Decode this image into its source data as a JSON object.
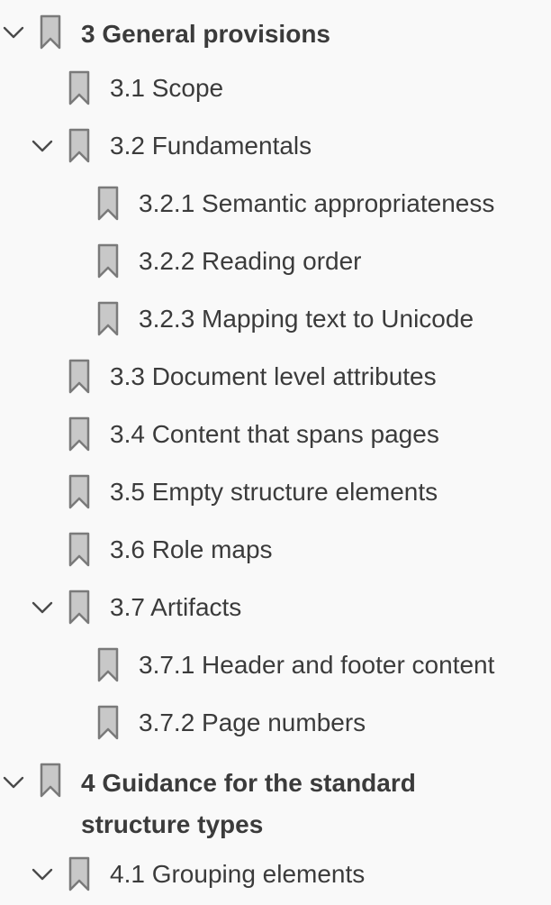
{
  "bookmarks": [
    {
      "label": "3 General provisions",
      "level": 0,
      "expanded": true,
      "bold": true
    },
    {
      "label": "3.1 Scope",
      "level": 1,
      "expanded": null,
      "bold": false
    },
    {
      "label": "3.2 Fundamentals",
      "level": 1,
      "expanded": true,
      "bold": false
    },
    {
      "label": "3.2.1 Semantic appropriateness",
      "level": 2,
      "expanded": null,
      "bold": false
    },
    {
      "label": "3.2.2 Reading order",
      "level": 2,
      "expanded": null,
      "bold": false
    },
    {
      "label": "3.2.3 Mapping text to Unicode",
      "level": 2,
      "expanded": null,
      "bold": false
    },
    {
      "label": "3.3 Document level attributes",
      "level": 1,
      "expanded": null,
      "bold": false
    },
    {
      "label": "3.4 Content that spans pages",
      "level": 1,
      "expanded": null,
      "bold": false
    },
    {
      "label": "3.5 Empty structure elements",
      "level": 1,
      "expanded": null,
      "bold": false
    },
    {
      "label": "3.6 Role maps",
      "level": 1,
      "expanded": null,
      "bold": false
    },
    {
      "label": "3.7 Artifacts",
      "level": 1,
      "expanded": true,
      "bold": false
    },
    {
      "label": "3.7.1 Header and footer content",
      "level": 2,
      "expanded": null,
      "bold": false
    },
    {
      "label": "3.7.2 Page numbers",
      "level": 2,
      "expanded": null,
      "bold": false
    },
    {
      "label": "4 Guidance for the standard structure types",
      "level": 0,
      "expanded": true,
      "bold": true
    },
    {
      "label": "4.1 Grouping elements",
      "level": 1,
      "expanded": true,
      "bold": false
    }
  ],
  "icons": {
    "bookmark": "bookmark-icon",
    "chevron": "chevron-down-icon"
  },
  "colors": {
    "background": "#f9f9f9",
    "text": "#3b3b3b",
    "bookmark_fill": "#c8c8c8",
    "bookmark_stroke": "#7a7a7a",
    "chevron": "#4a4a4a"
  }
}
